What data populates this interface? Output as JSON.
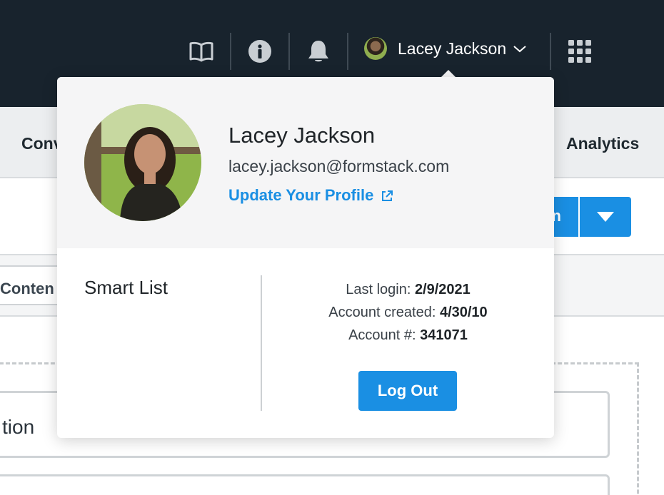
{
  "header": {
    "icons": [
      "book-icon",
      "info-icon",
      "bell-icon",
      "apps-grid-icon"
    ],
    "user_name": "Lacey Jackson"
  },
  "background": {
    "subnav_left_fragment": "Conv",
    "subnav_right": "Analytics",
    "create_fragment": "n",
    "tab_fragment": "Conten",
    "card_fragment": "tion"
  },
  "profile": {
    "name": "Lacey Jackson",
    "email": "lacey.jackson@formstack.com",
    "update_link": "Update Your Profile",
    "smart_list_label": "Smart List",
    "last_login_label": "Last login:",
    "last_login_value": "2/9/2021",
    "created_label": "Account created:",
    "created_value": "4/30/10",
    "account_label": "Account #:",
    "account_value": "341071",
    "logout_label": "Log Out"
  },
  "colors": {
    "header_bg": "#18232d",
    "accent": "#1a8fe3",
    "popup_top_bg": "#f5f5f6"
  }
}
